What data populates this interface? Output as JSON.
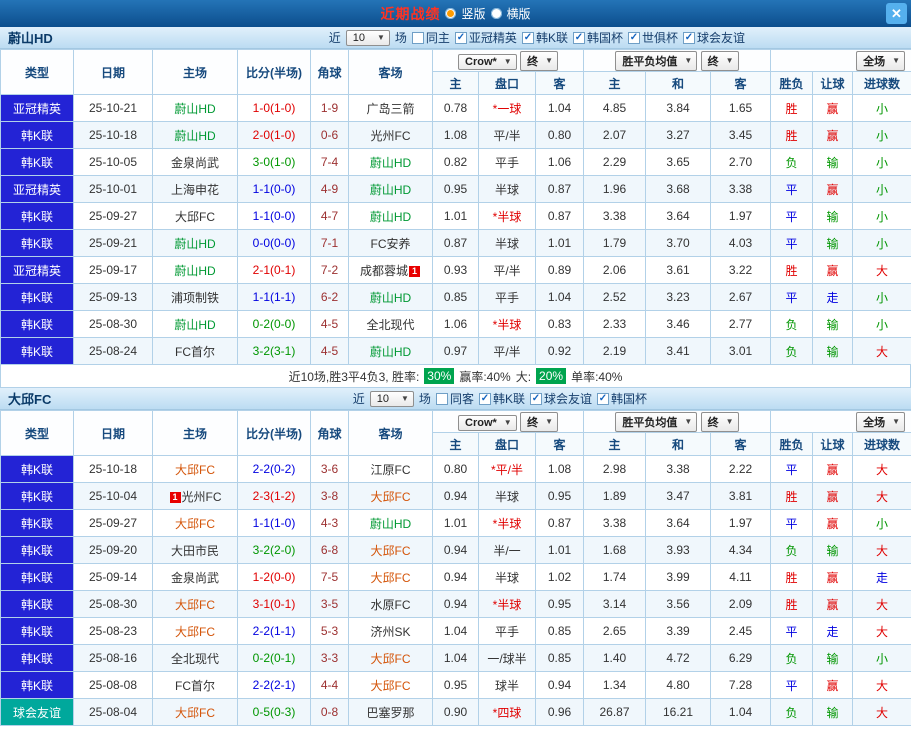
{
  "topbar": {
    "title": "近期战绩",
    "options": [
      {
        "label": "竖版",
        "selected": true
      },
      {
        "label": "横版",
        "selected": false
      }
    ],
    "close_glyph": "✕"
  },
  "glyphs": {
    "arrow": "▼",
    "check": "✓"
  },
  "colors": {
    "win_red": "#e00000",
    "draw_blue": "#0000e0",
    "loss_green": "#009600",
    "team_ulsan_green": "#009933",
    "team_daegu_orange": "#d4550a",
    "league_type_blue": "#2323d5",
    "friendly_type_teal": "#00a89c",
    "summary_badge_green": "#00a44e",
    "title_red": "#ff3322"
  },
  "table_header": {
    "cols": [
      "类型",
      "日期",
      "主场",
      "比分(半场)",
      "角球",
      "客场"
    ],
    "bookmaker": "Crow*",
    "final": "终",
    "avg": "胜平负均值",
    "scope": "全场",
    "subs": [
      "主",
      "盘口",
      "客",
      "主",
      "和",
      "客",
      "胜负",
      "让球",
      "进球数"
    ]
  },
  "sections": [
    {
      "team": "蔚山HD",
      "filters": {
        "near": "近",
        "count": "10",
        "games": "场",
        "same_label": "同主",
        "same_checked": false,
        "comps": [
          "亚冠精英",
          "韩K联",
          "韩国杯",
          "世俱杯",
          "球会友谊"
        ]
      },
      "rows": [
        {
          "t": "亚冠精英",
          "tb": "b",
          "d": "25-10-21",
          "h": "蔚山HD",
          "hc": "tg",
          "s": "1-0(1-0)",
          "sc": "r",
          "cr": "1-9",
          "a": "广岛三箭",
          "ac": "k",
          "o1": "0.78",
          "cp": "*一球",
          "cpc": "r",
          "o2": "1.04",
          "m1": "4.85",
          "m2": "3.84",
          "m3": "1.65",
          "r": "胜",
          "rc": "r",
          "l": "赢",
          "lc": "r",
          "g": "小",
          "gc": "g"
        },
        {
          "t": "韩K联",
          "tb": "b",
          "d": "25-10-18",
          "h": "蔚山HD",
          "hc": "tg",
          "s": "2-0(1-0)",
          "sc": "r",
          "cr": "0-6",
          "a": "光州FC",
          "ac": "k",
          "o1": "1.08",
          "cp": "平/半",
          "cpc": "k",
          "o2": "0.80",
          "m1": "2.07",
          "m2": "3.27",
          "m3": "3.45",
          "r": "胜",
          "rc": "r",
          "l": "赢",
          "lc": "r",
          "g": "小",
          "gc": "g"
        },
        {
          "t": "韩K联",
          "tb": "b",
          "d": "25-10-05",
          "h": "金泉尚武",
          "hc": "k",
          "s": "3-0(1-0)",
          "sc": "g",
          "cr": "7-4",
          "a": "蔚山HD",
          "ac": "tg",
          "o1": "0.82",
          "cp": "平手",
          "cpc": "k",
          "o2": "1.06",
          "m1": "2.29",
          "m2": "3.65",
          "m3": "2.70",
          "r": "负",
          "rc": "g",
          "l": "输",
          "lc": "g",
          "g": "小",
          "gc": "g"
        },
        {
          "t": "亚冠精英",
          "tb": "b",
          "d": "25-10-01",
          "h": "上海申花",
          "hc": "k",
          "s": "1-1(0-0)",
          "sc": "b",
          "cr": "4-9",
          "a": "蔚山HD",
          "ac": "tg",
          "o1": "0.95",
          "cp": "半球",
          "cpc": "k",
          "o2": "0.87",
          "m1": "1.96",
          "m2": "3.68",
          "m3": "3.38",
          "r": "平",
          "rc": "b",
          "l": "赢",
          "lc": "r",
          "g": "小",
          "gc": "g"
        },
        {
          "t": "韩K联",
          "tb": "b",
          "d": "25-09-27",
          "h": "大邱FC",
          "hc": "k",
          "s": "1-1(0-0)",
          "sc": "b",
          "cr": "4-7",
          "a": "蔚山HD",
          "ac": "tg",
          "o1": "1.01",
          "cp": "*半球",
          "cpc": "r",
          "o2": "0.87",
          "m1": "3.38",
          "m2": "3.64",
          "m3": "1.97",
          "r": "平",
          "rc": "b",
          "l": "输",
          "lc": "g",
          "g": "小",
          "gc": "g"
        },
        {
          "t": "韩K联",
          "tb": "b",
          "d": "25-09-21",
          "h": "蔚山HD",
          "hc": "tg",
          "s": "0-0(0-0)",
          "sc": "b",
          "cr": "7-1",
          "a": "FC安养",
          "ac": "k",
          "o1": "0.87",
          "cp": "半球",
          "cpc": "k",
          "o2": "1.01",
          "m1": "1.79",
          "m2": "3.70",
          "m3": "4.03",
          "r": "平",
          "rc": "b",
          "l": "输",
          "lc": "g",
          "g": "小",
          "gc": "g"
        },
        {
          "t": "亚冠精英",
          "tb": "b",
          "d": "25-09-17",
          "h": "蔚山HD",
          "hc": "tg",
          "s": "2-1(0-1)",
          "sc": "r",
          "cr": "7-2",
          "a": "成都蓉城",
          "ac": "k",
          "ab": "1",
          "abp": "after",
          "o1": "0.93",
          "cp": "平/半",
          "cpc": "k",
          "o2": "0.89",
          "m1": "2.06",
          "m2": "3.61",
          "m3": "3.22",
          "r": "胜",
          "rc": "r",
          "l": "赢",
          "lc": "r",
          "g": "大",
          "gc": "r"
        },
        {
          "t": "韩K联",
          "tb": "b",
          "d": "25-09-13",
          "h": "浦项制铁",
          "hc": "k",
          "s": "1-1(1-1)",
          "sc": "b",
          "cr": "6-2",
          "a": "蔚山HD",
          "ac": "tg",
          "o1": "0.85",
          "cp": "平手",
          "cpc": "k",
          "o2": "1.04",
          "m1": "2.52",
          "m2": "3.23",
          "m3": "2.67",
          "r": "平",
          "rc": "b",
          "l": "走",
          "lc": "b",
          "g": "小",
          "gc": "g"
        },
        {
          "t": "韩K联",
          "tb": "b",
          "d": "25-08-30",
          "h": "蔚山HD",
          "hc": "tg",
          "s": "0-2(0-0)",
          "sc": "g",
          "cr": "4-5",
          "a": "全北现代",
          "ac": "k",
          "o1": "1.06",
          "cp": "*半球",
          "cpc": "r",
          "o2": "0.83",
          "m1": "2.33",
          "m2": "3.46",
          "m3": "2.77",
          "r": "负",
          "rc": "g",
          "l": "输",
          "lc": "g",
          "g": "小",
          "gc": "g"
        },
        {
          "t": "韩K联",
          "tb": "b",
          "d": "25-08-24",
          "h": "FC首尔",
          "hc": "k",
          "s": "3-2(3-1)",
          "sc": "g",
          "cr": "4-5",
          "a": "蔚山HD",
          "ac": "tg",
          "o1": "0.97",
          "cp": "平/半",
          "cpc": "k",
          "o2": "0.92",
          "m1": "2.19",
          "m2": "3.41",
          "m3": "3.01",
          "r": "负",
          "rc": "g",
          "l": "输",
          "lc": "g",
          "g": "大",
          "gc": "r"
        }
      ],
      "summary": {
        "parts": [
          {
            "text": "近10场,胜3平4负3, 胜率:",
            "badge": false
          },
          {
            "text": "30%",
            "badge": true
          },
          {
            "text": "赢率:40%",
            "badge": false
          },
          {
            "text": "大:",
            "badge": false
          },
          {
            "text": "20%",
            "badge": true
          },
          {
            "text": "单率:40%",
            "badge": false
          }
        ]
      }
    },
    {
      "team": "大邱FC",
      "filters": {
        "near": "近",
        "count": "10",
        "games": "场",
        "same_label": "同客",
        "same_checked": false,
        "comps": [
          "韩K联",
          "球会友谊",
          "韩国杯"
        ]
      },
      "rows": [
        {
          "t": "韩K联",
          "tb": "b",
          "d": "25-10-18",
          "h": "大邱FC",
          "hc": "to",
          "s": "2-2(0-2)",
          "sc": "b",
          "cr": "3-6",
          "a": "江原FC",
          "ac": "k",
          "o1": "0.80",
          "cp": "*平/半",
          "cpc": "r",
          "o2": "1.08",
          "m1": "2.98",
          "m2": "3.38",
          "m3": "2.22",
          "r": "平",
          "rc": "b",
          "l": "赢",
          "lc": "r",
          "g": "大",
          "gc": "r"
        },
        {
          "t": "韩K联",
          "tb": "b",
          "d": "25-10-04",
          "h": "光州FC",
          "hc": "k",
          "hb": "1",
          "hbp": "before",
          "s": "2-3(1-2)",
          "sc": "r",
          "cr": "3-8",
          "a": "大邱FC",
          "ac": "to",
          "o1": "0.94",
          "cp": "半球",
          "cpc": "k",
          "o2": "0.95",
          "m1": "1.89",
          "m2": "3.47",
          "m3": "3.81",
          "r": "胜",
          "rc": "r",
          "l": "赢",
          "lc": "r",
          "g": "大",
          "gc": "r"
        },
        {
          "t": "韩K联",
          "tb": "b",
          "d": "25-09-27",
          "h": "大邱FC",
          "hc": "to",
          "s": "1-1(1-0)",
          "sc": "b",
          "cr": "4-3",
          "a": "蔚山HD",
          "ac": "tg",
          "o1": "1.01",
          "cp": "*半球",
          "cpc": "r",
          "o2": "0.87",
          "m1": "3.38",
          "m2": "3.64",
          "m3": "1.97",
          "r": "平",
          "rc": "b",
          "l": "赢",
          "lc": "r",
          "g": "小",
          "gc": "g"
        },
        {
          "t": "韩K联",
          "tb": "b",
          "d": "25-09-20",
          "h": "大田市民",
          "hc": "k",
          "s": "3-2(2-0)",
          "sc": "g",
          "cr": "6-8",
          "a": "大邱FC",
          "ac": "to",
          "o1": "0.94",
          "cp": "半/一",
          "cpc": "k",
          "o2": "1.01",
          "m1": "1.68",
          "m2": "3.93",
          "m3": "4.34",
          "r": "负",
          "rc": "g",
          "l": "输",
          "lc": "g",
          "g": "大",
          "gc": "r"
        },
        {
          "t": "韩K联",
          "tb": "b",
          "d": "25-09-14",
          "h": "金泉尚武",
          "hc": "k",
          "s": "1-2(0-0)",
          "sc": "r",
          "cr": "7-5",
          "a": "大邱FC",
          "ac": "to",
          "o1": "0.94",
          "cp": "半球",
          "cpc": "k",
          "o2": "1.02",
          "m1": "1.74",
          "m2": "3.99",
          "m3": "4.11",
          "r": "胜",
          "rc": "r",
          "l": "赢",
          "lc": "r",
          "g": "走",
          "gc": "b"
        },
        {
          "t": "韩K联",
          "tb": "b",
          "d": "25-08-30",
          "h": "大邱FC",
          "hc": "to",
          "s": "3-1(0-1)",
          "sc": "r",
          "cr": "3-5",
          "a": "水原FC",
          "ac": "k",
          "o1": "0.94",
          "cp": "*半球",
          "cpc": "r",
          "o2": "0.95",
          "m1": "3.14",
          "m2": "3.56",
          "m3": "2.09",
          "r": "胜",
          "rc": "r",
          "l": "赢",
          "lc": "r",
          "g": "大",
          "gc": "r"
        },
        {
          "t": "韩K联",
          "tb": "b",
          "d": "25-08-23",
          "h": "大邱FC",
          "hc": "to",
          "s": "2-2(1-1)",
          "sc": "b",
          "cr": "5-3",
          "a": "济州SK",
          "ac": "k",
          "o1": "1.04",
          "cp": "平手",
          "cpc": "k",
          "o2": "0.85",
          "m1": "2.65",
          "m2": "3.39",
          "m3": "2.45",
          "r": "平",
          "rc": "b",
          "l": "走",
          "lc": "b",
          "g": "大",
          "gc": "r"
        },
        {
          "t": "韩K联",
          "tb": "b",
          "d": "25-08-16",
          "h": "全北现代",
          "hc": "k",
          "s": "0-2(0-1)",
          "sc": "g",
          "cr": "3-3",
          "a": "大邱FC",
          "ac": "to",
          "o1": "1.04",
          "cp": "一/球半",
          "cpc": "k",
          "o2": "0.85",
          "m1": "1.40",
          "m2": "4.72",
          "m3": "6.29",
          "r": "负",
          "rc": "g",
          "l": "输",
          "lc": "g",
          "g": "小",
          "gc": "g"
        },
        {
          "t": "韩K联",
          "tb": "b",
          "d": "25-08-08",
          "h": "FC首尔",
          "hc": "k",
          "s": "2-2(2-1)",
          "sc": "b",
          "cr": "4-4",
          "a": "大邱FC",
          "ac": "to",
          "o1": "0.95",
          "cp": "球半",
          "cpc": "k",
          "o2": "0.94",
          "m1": "1.34",
          "m2": "4.80",
          "m3": "7.28",
          "r": "平",
          "rc": "b",
          "l": "赢",
          "lc": "r",
          "g": "大",
          "gc": "r"
        },
        {
          "t": "球会友谊",
          "tb": "t",
          "d": "25-08-04",
          "h": "大邱FC",
          "hc": "to",
          "s": "0-5(0-3)",
          "sc": "g",
          "cr": "0-8",
          "a": "巴塞罗那",
          "ac": "k",
          "o1": "0.90",
          "cp": "*四球",
          "cpc": "r",
          "o2": "0.96",
          "m1": "26.87",
          "m2": "16.21",
          "m3": "1.04",
          "r": "负",
          "rc": "g",
          "l": "输",
          "lc": "g",
          "g": "大",
          "gc": "r"
        }
      ],
      "summary": null
    }
  ]
}
